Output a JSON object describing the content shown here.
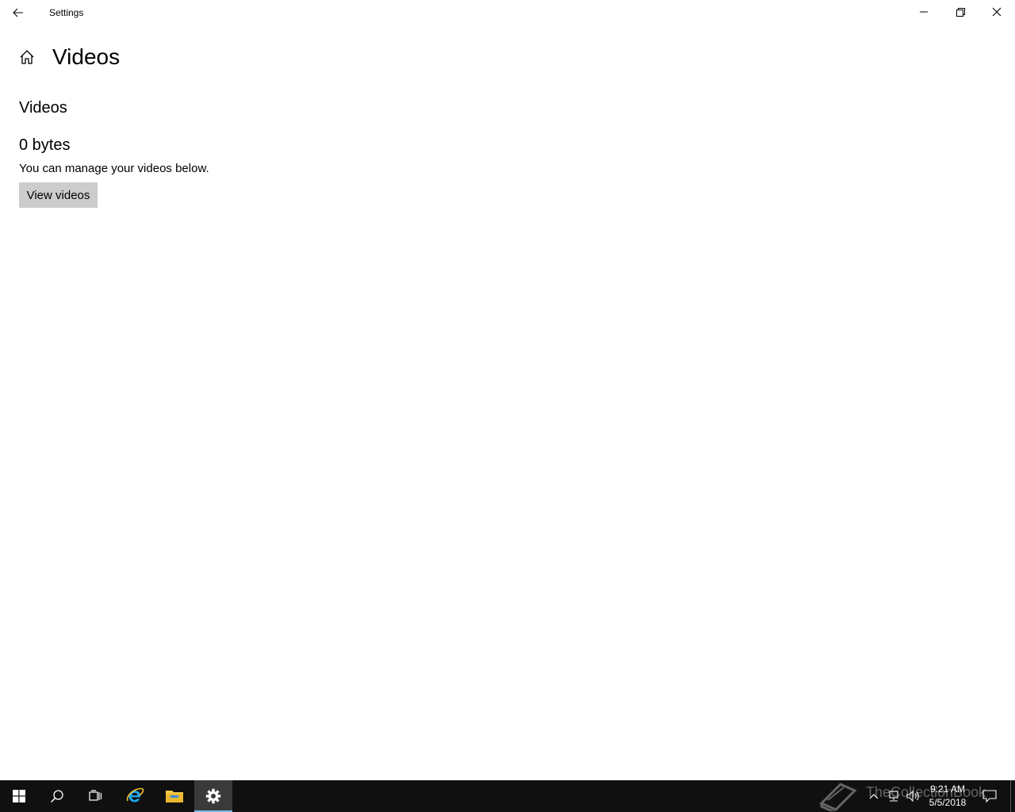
{
  "window": {
    "title": "Settings",
    "back_icon": "back-arrow-icon",
    "minimize_icon": "minimize-icon",
    "restore_icon": "restore-icon",
    "close_icon": "close-icon"
  },
  "header": {
    "home_icon": "home-icon",
    "title": "Videos"
  },
  "content": {
    "section_title": "Videos",
    "size": "0 bytes",
    "description": "You can manage your videos below.",
    "button_label": "View videos"
  },
  "taskbar": {
    "apps": [
      {
        "name": "start",
        "icon": "windows-logo-icon"
      },
      {
        "name": "search",
        "icon": "search-icon"
      },
      {
        "name": "task-view",
        "icon": "task-view-icon"
      },
      {
        "name": "internet-explorer",
        "icon": "internet-explorer-icon"
      },
      {
        "name": "file-explorer",
        "icon": "folder-icon"
      },
      {
        "name": "settings",
        "icon": "gear-icon",
        "active": true
      }
    ],
    "watermark_text": "TheCollectionBook",
    "tray": {
      "time": "9:21 AM",
      "date": "5/5/2018"
    },
    "accent_color": "#76b9ed"
  }
}
